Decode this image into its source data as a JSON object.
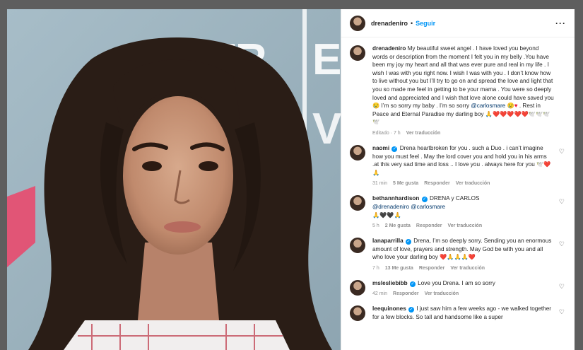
{
  "post": {
    "username": "drenadeniro",
    "follow_label": "Seguir",
    "caption": {
      "username": "drenadeniro",
      "text": "My beautiful sweet angel . I have loved you beyond words or description from the moment I felt you in my belly .You have been my joy my heart and all that was ever pure and real in my life . I wish I was with you right now. I wish I was with you . I don’t know how to live without you but I’ll try to go on and spread the love and light that you so made me feel in getting to be your mama . You were so deeply loved and appreciated and I wish that love alone could have saved you",
      "text_2": "I’m so sorry my baby . I’m so sorry",
      "mention": "@carlosmare",
      "text_3": ". Rest in Peace and Eternal Paradise my darling boy",
      "emoji_tail": "🙏❤️❤️❤️❤️❤️🕊️🕊️🕊️🕊️",
      "edited": "Editado · 7 h",
      "see_translation": "Ver traducción"
    }
  },
  "comments": [
    {
      "username": "naomi",
      "verified": true,
      "text": "Drena heartbroken for you . such a Duo . i can’t imagine how you must feel . May the lord cover you and hold you in his arms .at this very sad time and loss .. I love you . always here for you",
      "emoji_tail": "🕊️❤️🙏",
      "time": "31 min",
      "likes": "5 Me gusta",
      "reply": "Responder",
      "translate": "Ver traducción"
    },
    {
      "username": "bethannhardison",
      "verified": true,
      "text": "DRENA y CARLOS",
      "mention_1": "@drenadeniro",
      "mention_2": "@carlosmare",
      "emoji_tail": "🙏🖤🖤🙏",
      "time": "5 h",
      "likes": "2 Me gusta",
      "reply": "Responder",
      "translate": "Ver traducción"
    },
    {
      "username": "lanaparrilla",
      "verified": true,
      "text": "Drena, I’m so deeply sorry. Sending you an enormous amount of love, prayers and strength. May God be with you and all who love your darling boy",
      "emoji_tail": "❤️🙏🙏🙏❤️",
      "time": "7 h",
      "likes": "13 Me gusta",
      "reply": "Responder",
      "translate": "Ver traducción"
    },
    {
      "username": "mslesliebibb",
      "verified": true,
      "text": "Love you Drena. I am so sorry",
      "emoji_tail": "",
      "time": "42 min",
      "likes": "",
      "reply": "Responder",
      "translate": "Ver traducción"
    },
    {
      "username": "leequinones",
      "verified": true,
      "text": "I just saw him a few weeks ago - we walked together for a few blocks. So tall and handsome like a super",
      "emoji_tail": "",
      "time": "",
      "likes": "",
      "reply": "",
      "translate": ""
    }
  ],
  "photo": {
    "backdrop_text_1": "TR",
    "backdrop_text_2": "E",
    "backdrop_text_3": "T",
    "backdrop_text_4": "V",
    "backdrop_color": "#9db2bd"
  }
}
